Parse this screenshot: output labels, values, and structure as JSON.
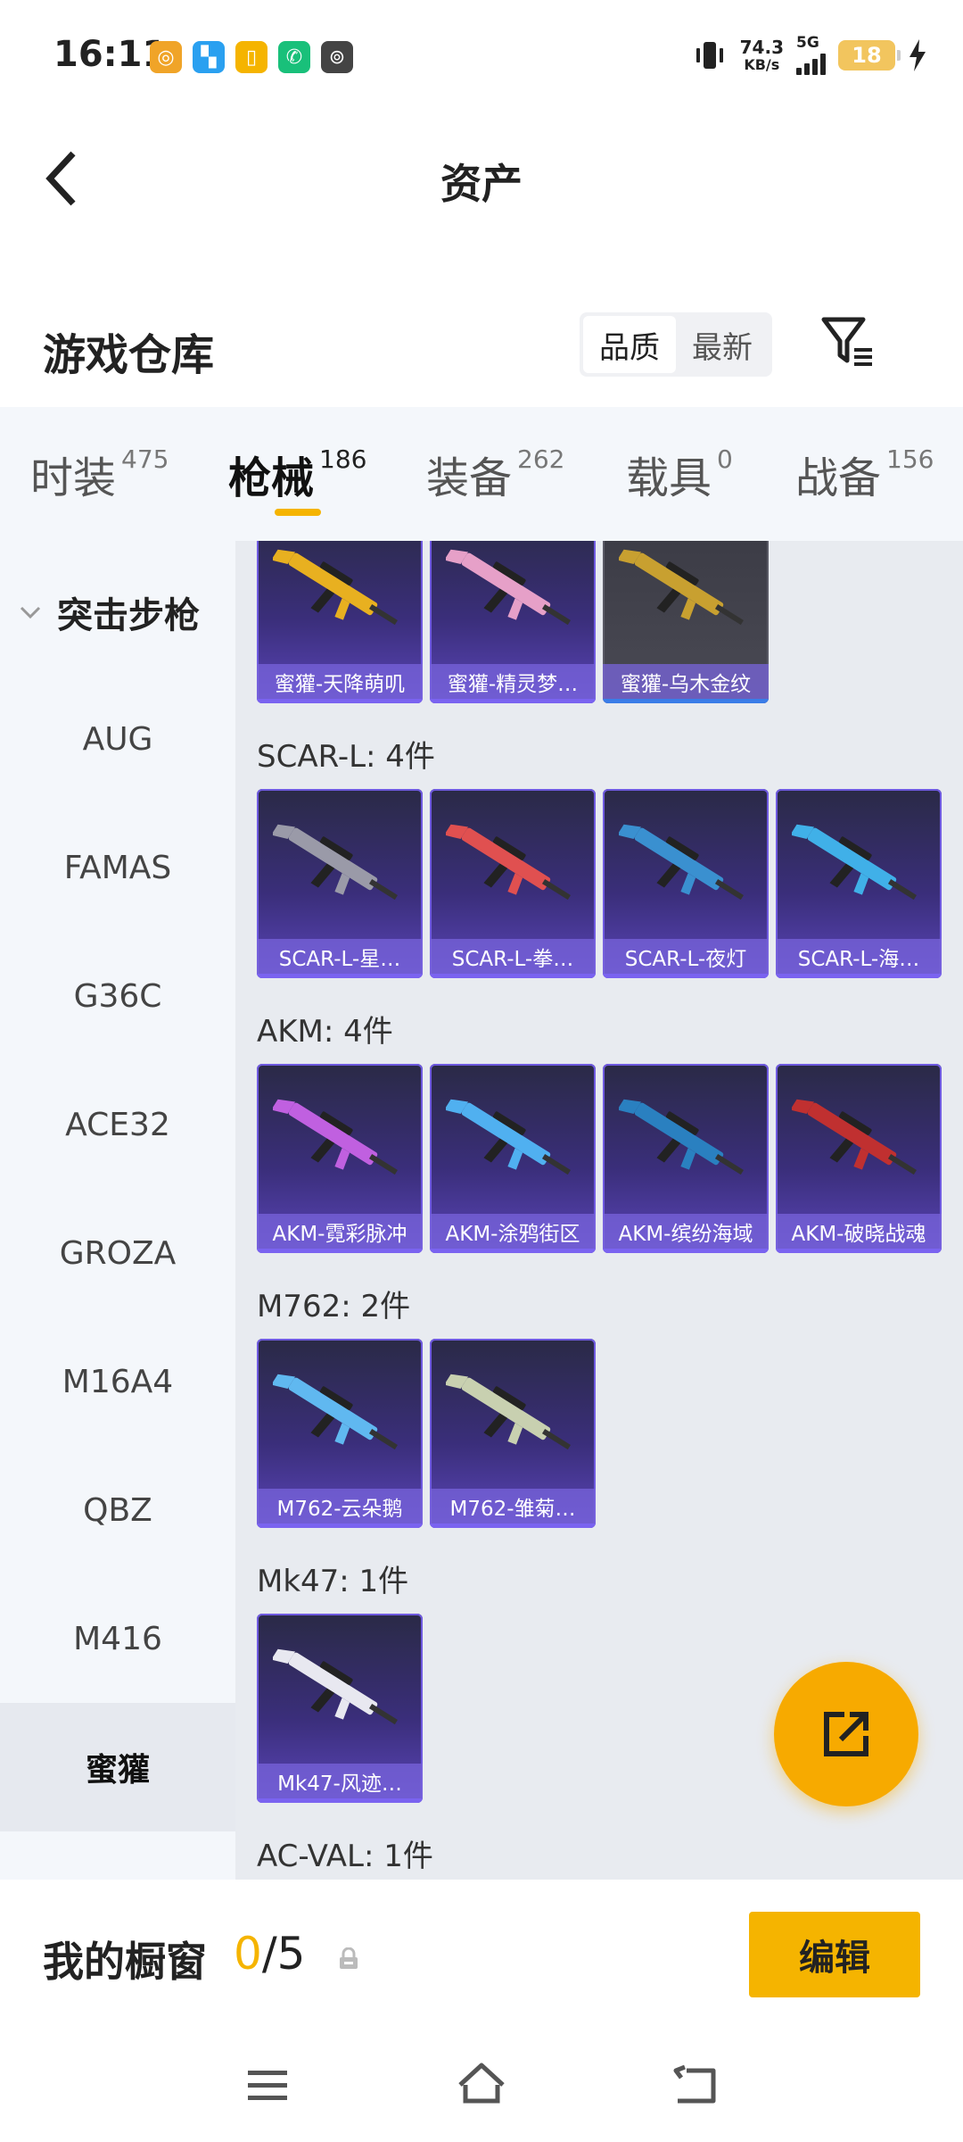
{
  "status_bar": {
    "time": "16:11",
    "net_speed_value": "74.3",
    "net_speed_unit": "KB/s",
    "network": "5G",
    "battery": "18",
    "notif_icons": [
      {
        "name": "app-icon-orange",
        "color": "#f0a428",
        "glyph": "◎"
      },
      {
        "name": "app-icon-blue",
        "color": "#2aa0f0",
        "glyph": "▚"
      },
      {
        "name": "app-icon-yellow",
        "color": "#f5b400",
        "glyph": "▯"
      },
      {
        "name": "app-icon-green",
        "color": "#19c07a",
        "glyph": "✆"
      },
      {
        "name": "app-icon-weibo",
        "color": "#444444",
        "glyph": "⊚"
      }
    ]
  },
  "header": {
    "title": "资产"
  },
  "section": {
    "title": "游戏仓库",
    "sort_options": [
      "品质",
      "最新"
    ],
    "sort_active": 0
  },
  "tabs": [
    {
      "name": "时装",
      "count": "475"
    },
    {
      "name": "枪械",
      "count": "186"
    },
    {
      "name": "装备",
      "count": "262"
    },
    {
      "name": "载具",
      "count": "0"
    },
    {
      "name": "战备",
      "count": "156"
    }
  ],
  "active_tab": 1,
  "sidebar": {
    "group": "突击步枪",
    "items": [
      "AUG",
      "FAMAS",
      "G36C",
      "ACE32",
      "GROZA",
      "M16A4",
      "QBZ",
      "M416",
      "蜜獾"
    ],
    "active_index": 8
  },
  "groups": [
    {
      "label": "",
      "cards": [
        {
          "name": "蜜獾-天降萌叽",
          "color": "#e8b020",
          "style": "purple"
        },
        {
          "name": "蜜獾-精灵梦…",
          "color": "#e6a0c8",
          "style": "purple"
        },
        {
          "name": "蜜獾-乌木金纹",
          "color": "#c8a030",
          "style": "dark"
        }
      ]
    },
    {
      "label": "SCAR-L: 4件",
      "cards": [
        {
          "name": "SCAR-L-星…",
          "color": "#9a9aa8",
          "style": "purple"
        },
        {
          "name": "SCAR-L-拳…",
          "color": "#e05050",
          "style": "purple"
        },
        {
          "name": "SCAR-L-夜灯",
          "color": "#3a90d0",
          "style": "purple"
        },
        {
          "name": "SCAR-L-海…",
          "color": "#40b0e8",
          "style": "purple"
        }
      ]
    },
    {
      "label": "AKM: 4件",
      "cards": [
        {
          "name": "AKM-霓彩脉冲",
          "color": "#c060e0",
          "style": "purple"
        },
        {
          "name": "AKM-涂鸦街区",
          "color": "#50b0f0",
          "style": "purple"
        },
        {
          "name": "AKM-缤纷海域",
          "color": "#2a80c0",
          "style": "purple"
        },
        {
          "name": "AKM-破晓战魂",
          "color": "#c03030",
          "style": "purple"
        }
      ]
    },
    {
      "label": "M762: 2件",
      "cards": [
        {
          "name": "M762-云朵鹅",
          "color": "#60b8f0",
          "style": "purple"
        },
        {
          "name": "M762-雏菊…",
          "color": "#c8d0b0",
          "style": "purple"
        }
      ]
    },
    {
      "label": "Mk47: 1件",
      "cards": [
        {
          "name": "Mk47-风迹…",
          "color": "#e8e8f0",
          "style": "purple"
        }
      ]
    },
    {
      "label": "AC-VAL: 1件",
      "cards": []
    }
  ],
  "window": {
    "label": "我的橱窗",
    "used": "0",
    "total": "/5",
    "edit_label": "编辑"
  },
  "colors": {
    "accent": "#f5b400",
    "card_top": "#2a2a46",
    "card_bottom": "#5a45b8"
  }
}
